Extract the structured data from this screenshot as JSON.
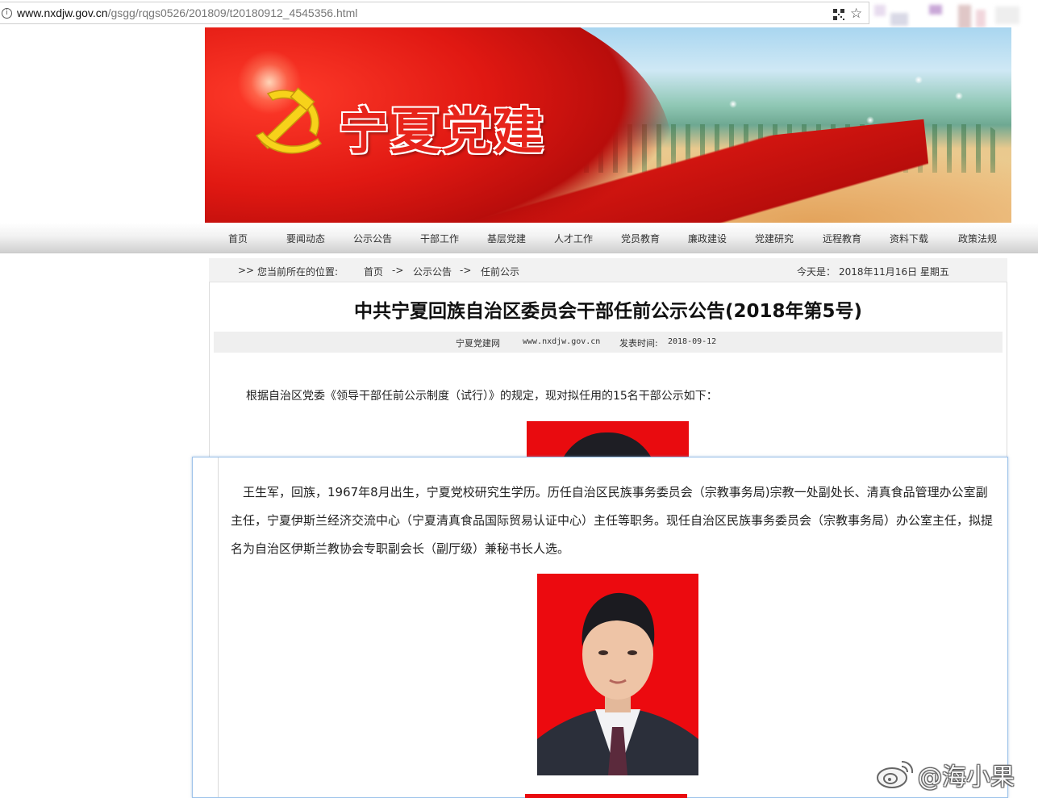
{
  "browser": {
    "url_domain": "www.nxdjw.gov.cn",
    "url_path": "/gsgg/rqgs0526/201809/t20180912_4545356.html",
    "info_icon_glyph": "i",
    "qr_icon": "qr-code-icon",
    "star_icon": "bookmark-star-icon"
  },
  "banner": {
    "title": "宁夏党建",
    "emblem": "party-emblem-icon",
    "accent_color": "#e7241b"
  },
  "nav": {
    "items": [
      "首页",
      "要闻动态",
      "公示公告",
      "干部工作",
      "基层党建",
      "人才工作",
      "党员教育",
      "廉政建设",
      "党建研究",
      "远程教育",
      "资料下载",
      "政策法规"
    ]
  },
  "breadcrumb": {
    "arrow": ">>",
    "label": "您当前所在的位置:",
    "home": "首页",
    "sep": "->",
    "section": "公示公告",
    "current": "任前公示",
    "date_label": "今天是：",
    "date_value": "2018年11月16日 星期五"
  },
  "article": {
    "title": "中共宁夏回族自治区委员会干部任前公示公告(2018年第5号)",
    "source": "宁夏党建网",
    "site": "www.nxdjw.gov.cn",
    "published_label": "发表时间:",
    "published_value": "2018-09-12",
    "intro": "根据自治区党委《领导干部任前公示制度（试行）》的规定，现对拟任用的15名干部公示如下："
  },
  "zoom": {
    "bio_lines": [
      "　王生军，回族，1967年8月出生，宁夏党校研究生学历。历任自治区民族事务委员会（宗教事务局)宗教一处副处长、清真食品管理办公室副",
      "主任，宁夏伊斯兰经济交流中心（宁夏清真食品国际贸易认证中心）主任等职务。现任自治区民族事务委员会（宗教事务局）办公室主任，拟提",
      "名为自治区伊斯兰教协会专职副会长（副厅级）兼秘书长人选。"
    ],
    "photo_bg_color": "#ec0a0f"
  },
  "watermark": {
    "text": "@海小果",
    "icon": "weibo-logo-icon"
  }
}
